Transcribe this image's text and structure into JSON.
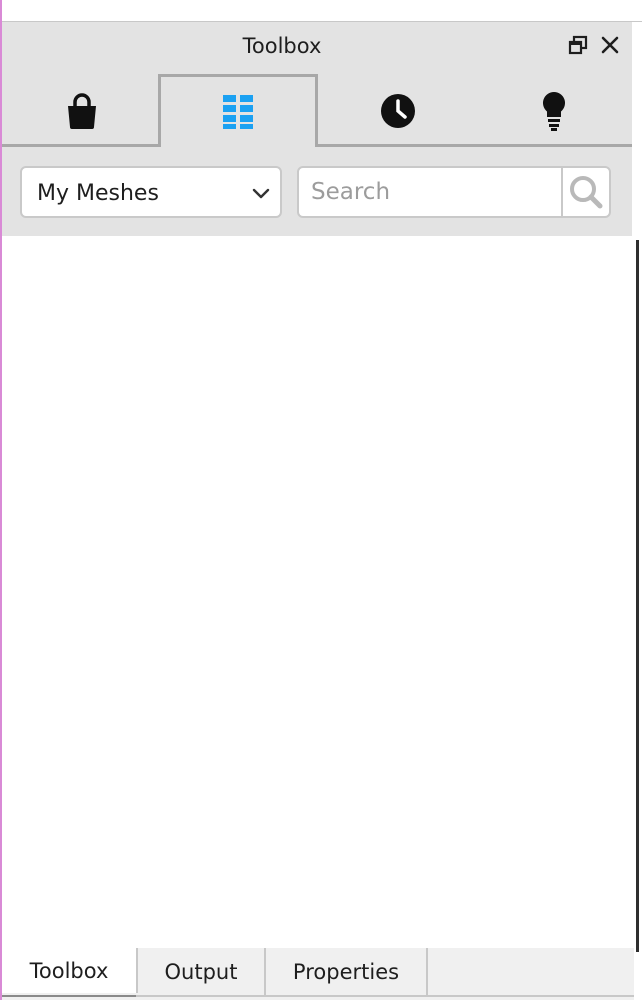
{
  "panel": {
    "title": "Toolbox"
  },
  "window_controls": {
    "restore_icon": "restore-window-icon",
    "close_icon": "close-icon"
  },
  "category_tabs": [
    {
      "icon": "shopping-bag-icon",
      "active": false
    },
    {
      "icon": "grid-icon",
      "active": true
    },
    {
      "icon": "clock-icon",
      "active": false
    },
    {
      "icon": "lightbulb-icon",
      "active": false
    }
  ],
  "filter": {
    "selected": "My Meshes",
    "search_placeholder": "Search"
  },
  "bottom_tabs": [
    {
      "label": "Toolbox",
      "active": true
    },
    {
      "label": "Output",
      "active": false
    },
    {
      "label": "Properties",
      "active": false
    }
  ],
  "colors": {
    "accent": "#1ba1f2",
    "panel_bg": "#e3e3e3",
    "border": "#a8a8a8"
  }
}
